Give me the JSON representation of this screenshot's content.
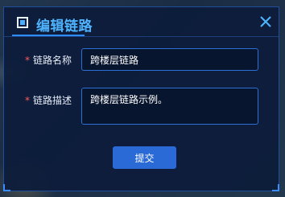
{
  "dialog": {
    "title": "编辑链路",
    "close_icon": "close-icon",
    "accent_color": "#4fb4ff"
  },
  "form": {
    "required_mark": "*",
    "name_label": "链路名称",
    "name_value": "跨楼层链路",
    "desc_label": "链路描述",
    "desc_value": "跨楼层链路示例。"
  },
  "actions": {
    "submit_label": "提交"
  }
}
